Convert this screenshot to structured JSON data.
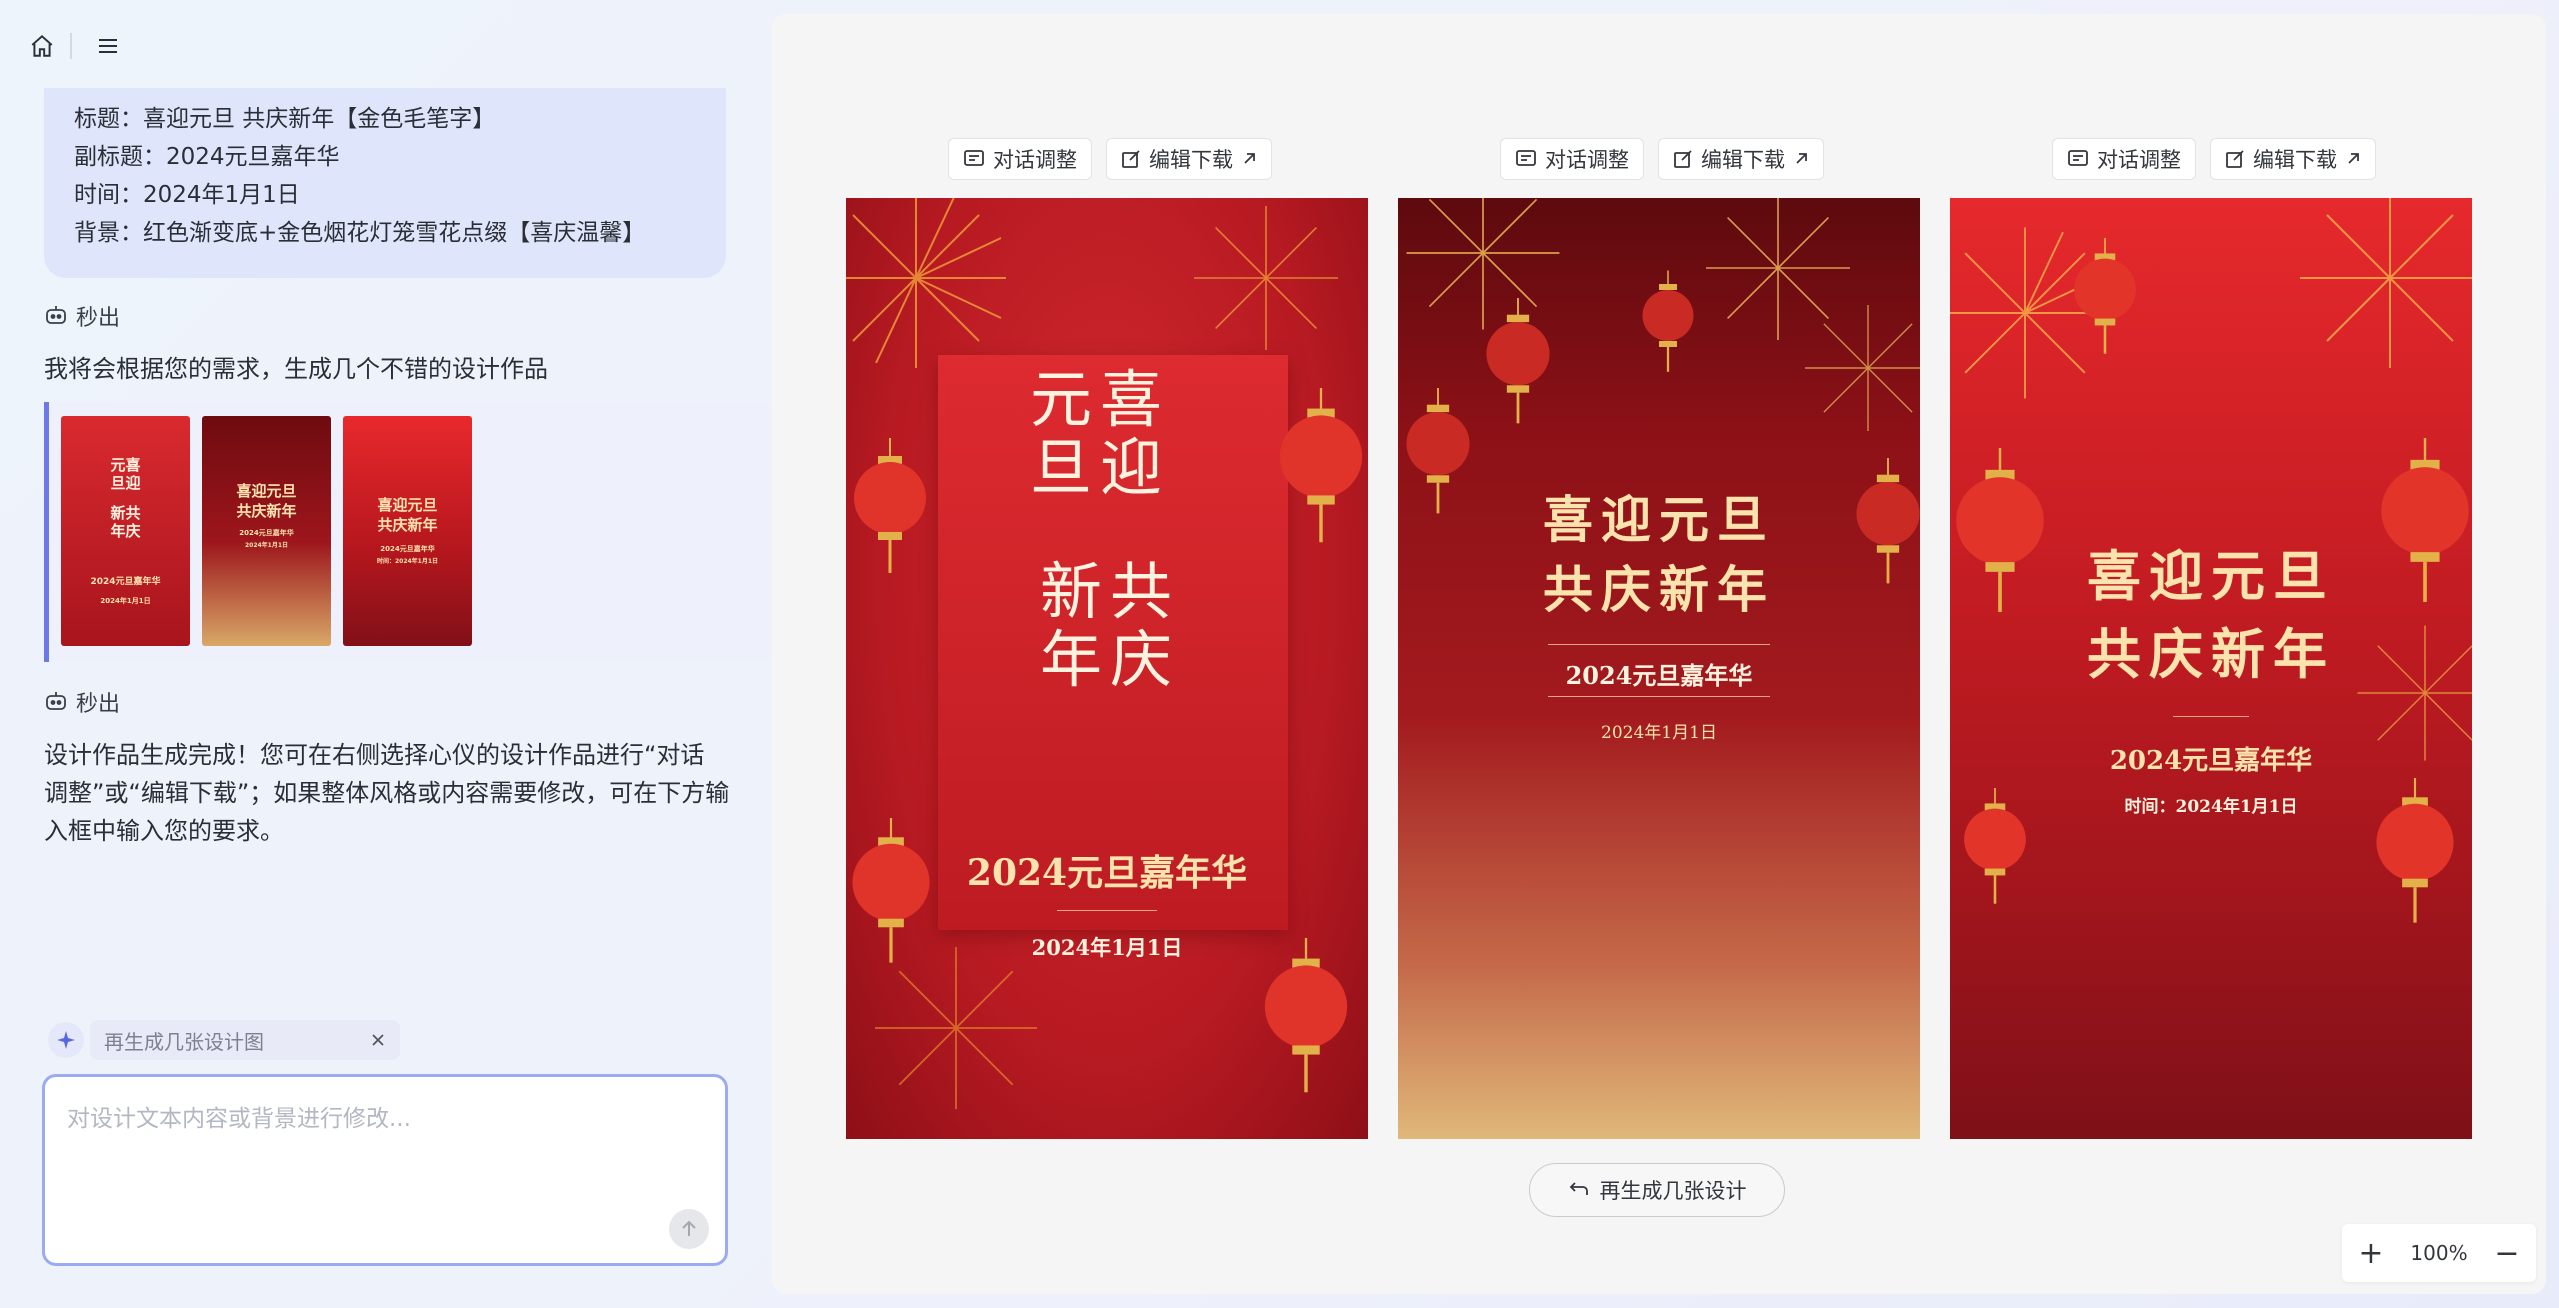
{
  "topbar": {
    "home_icon": "home-icon",
    "menu_icon": "menu-icon"
  },
  "brief": {
    "lines": [
      "标题：喜迎元旦 共庆新年【金色毛笔字】",
      "副标题：2024元旦嘉年华",
      "时间：2024年1月1日",
      "背景：红色渐变底+金色烟花灯笼雪花点缀【喜庆温馨】"
    ]
  },
  "bot": {
    "name": "秒出"
  },
  "messages": {
    "m1": "我将会根据您的需求，生成几个不错的设计作品",
    "m2_lines": [
      "设计作品生成完成！您可在右侧选择心仪的设计作品进行“对话",
      "调整”或“编辑下载”；如果整体风格或内容需要修改，可在下方输",
      "入框中输入您的要求。"
    ]
  },
  "thumbs": [
    {
      "title1": "元喜",
      "title2": "旦迎",
      "title3": "新共",
      "title4": "年庆",
      "sub": "2024元旦嘉年华",
      "date": "2024年1月1日"
    },
    {
      "title1": "喜迎元旦",
      "title2": "共庆新年",
      "sub": "2024元旦嘉年华",
      "date": "2024年1月1日"
    },
    {
      "title1": "喜迎元旦",
      "title2": "共庆新年",
      "sub": "2024元旦嘉年华",
      "date": "时间：2024年1月1日"
    }
  ],
  "chip": {
    "label": "再生成几张设计图"
  },
  "input": {
    "placeholder": "对设计文本内容或背景进行修改..."
  },
  "toolbar": {
    "chat_adjust": "对话调整",
    "edit_download": "编辑下载"
  },
  "posters": {
    "p1": {
      "col1_top": "元",
      "col1_bottom": "旦",
      "col2_top": "喜",
      "col2_bottom": "迎",
      "col3_top": "新",
      "col3_bottom": "年",
      "col4_top": "共",
      "col4_bottom": "庆",
      "subtitle": "2024元旦嘉年华",
      "date": "2024年1月1日"
    },
    "p2": {
      "line1": "喜迎元旦",
      "line2": "共庆新年",
      "subtitle": "2024元旦嘉年华",
      "date": "2024年1月1日"
    },
    "p3": {
      "line1": "喜迎元旦",
      "line2": "共庆新年",
      "subtitle": "2024元旦嘉年华",
      "date": "时间：2024年1月1日"
    }
  },
  "regen": {
    "label": "再生成几张设计"
  },
  "zoom": {
    "plus": "+",
    "value": "100%",
    "minus": "−"
  },
  "colors": {
    "accent": "#6c79e6",
    "poster_red": "#c81e25",
    "gold": "#fbe3ad"
  }
}
